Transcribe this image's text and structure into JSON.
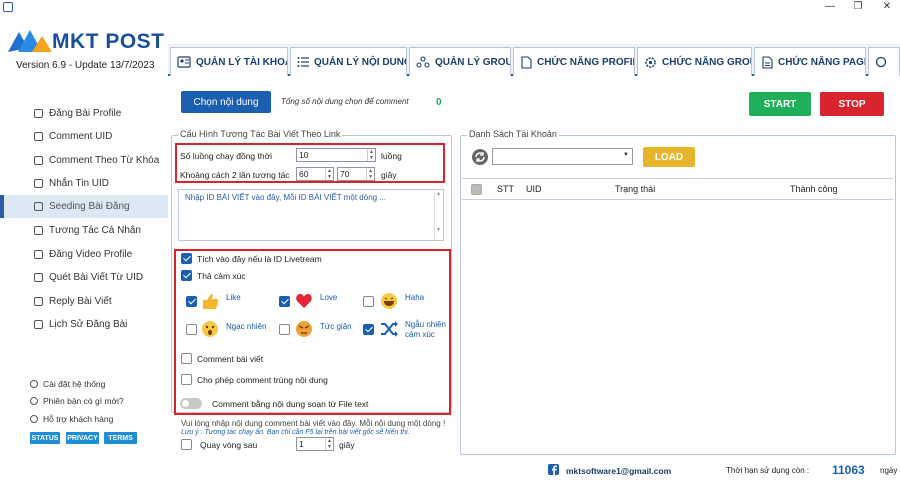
{
  "window": {
    "minimize": "—",
    "restore": "❐",
    "close": "✕"
  },
  "app": {
    "logo_text": "MKT POST",
    "version": "Version  6.9  - Update  13/7/2023"
  },
  "tabs": [
    {
      "label": "QUẢN LÝ TÀI KHOẢN",
      "icon": "id-card-icon"
    },
    {
      "label": "QUẢN LÝ NỘI DUNG",
      "icon": "list-icon"
    },
    {
      "label": "QUẢN LÝ GROUP",
      "icon": "group-icon"
    },
    {
      "label": "CHỨC NĂNG PROFILE",
      "icon": "profile-doc-icon"
    },
    {
      "label": "CHỨC NĂNG GROUP",
      "icon": "gear-icon"
    },
    {
      "label": "CHỨC NĂNG PAGE",
      "icon": "page-doc-icon"
    }
  ],
  "sidebar": {
    "items": [
      {
        "label": "Đăng Bài Profile"
      },
      {
        "label": "Comment UID"
      },
      {
        "label": "Comment Theo Từ Khóa"
      },
      {
        "label": "Nhắn Tin UID"
      },
      {
        "label": "Seeding Bài Đăng",
        "active": true
      },
      {
        "label": "Tương Tác Cá Nhân"
      },
      {
        "label": "Đăng Video Profile"
      },
      {
        "label": "Quét Bài Viết Từ UID"
      },
      {
        "label": "Reply Bài Viết"
      },
      {
        "label": "Lịch Sử Đăng Bài"
      }
    ],
    "footer": [
      {
        "label": "Cài đặt hệ thống",
        "icon": "settings-icon"
      },
      {
        "label": "Phiên bản có gì mới?",
        "icon": "info-icon"
      },
      {
        "label": "Hỗ trợ khách hàng",
        "icon": "support-icon"
      }
    ],
    "pills": [
      "STATUS",
      "PRIVACY",
      "TERMS"
    ]
  },
  "main": {
    "choose_content_button": "Chọn nội dung",
    "total_selected_label": "Tổng số nội dung chọn để comment",
    "total_selected_value": "0",
    "start_button": "START",
    "stop_button": "STOP",
    "config_group_title": "Cấu Hình Tương Tác Bài Viết Theo Link",
    "threads_label": "Số luồng chạy đồng thời",
    "threads_value": "10",
    "threads_unit": "luồng",
    "interval_label": "Khoảng cách 2 lần tương tác",
    "interval_min": "60",
    "interval_max": "70",
    "interval_unit": "giây",
    "post_ids_placeholder": "Nhập ID BÀI VIẾT vào đây, Mỗi ID BÀI VIẾT một dòng ...",
    "livestream_label": "Tích vào đây nếu là ID Livetream",
    "drop_emotion_label": "Thả cảm xúc",
    "emotions": [
      {
        "label": "Like",
        "checked": true,
        "icon": "like-icon"
      },
      {
        "label": "Love",
        "checked": true,
        "icon": "love-icon"
      },
      {
        "label": "Haha",
        "checked": false,
        "icon": "haha-icon"
      },
      {
        "label": "Ngạc nhiên",
        "checked": false,
        "icon": "wow-icon"
      },
      {
        "label": "Tức giận",
        "checked": false,
        "icon": "angry-icon"
      },
      {
        "label": "Ngẫu nhiên cảm xúc",
        "checked": true,
        "icon": "shuffle-icon"
      }
    ],
    "comment_post_label": "Comment bài viết",
    "allow_duplicate_label": "Cho phép comment trùng nội dung",
    "comment_file_label": "Comment bằng nội dung soạn từ File text",
    "hint_line1": "Vui lòng nhập nội dung comment bài viết vào đây. Mỗi nội dung một dòng !",
    "hint_line2": "Lưu ý : Tương tác chạy ẩn. Bạn chỉ cần F5 lại trên bài viết gốc sẽ hiển thị.",
    "after_label": "Quay vòng sau",
    "after_value": "1",
    "after_unit": "giây",
    "account_group_title": "Danh Sách Tài Khoản",
    "load_button": "LOAD",
    "table_headers": [
      "STT",
      "UID",
      "Trạng thái",
      "Thành công"
    ]
  },
  "footer": {
    "email": "mktsoftware1@gmail.com",
    "expiry_label": "Thời hạn sử dụng còn :",
    "expiry_value": "11063",
    "expiry_unit": "ngày"
  },
  "colors": {
    "accent": "#2a5ca8",
    "start": "#1fae5a",
    "stop": "#d9232d",
    "load": "#e7b52c",
    "highlight": "#d9232d"
  }
}
